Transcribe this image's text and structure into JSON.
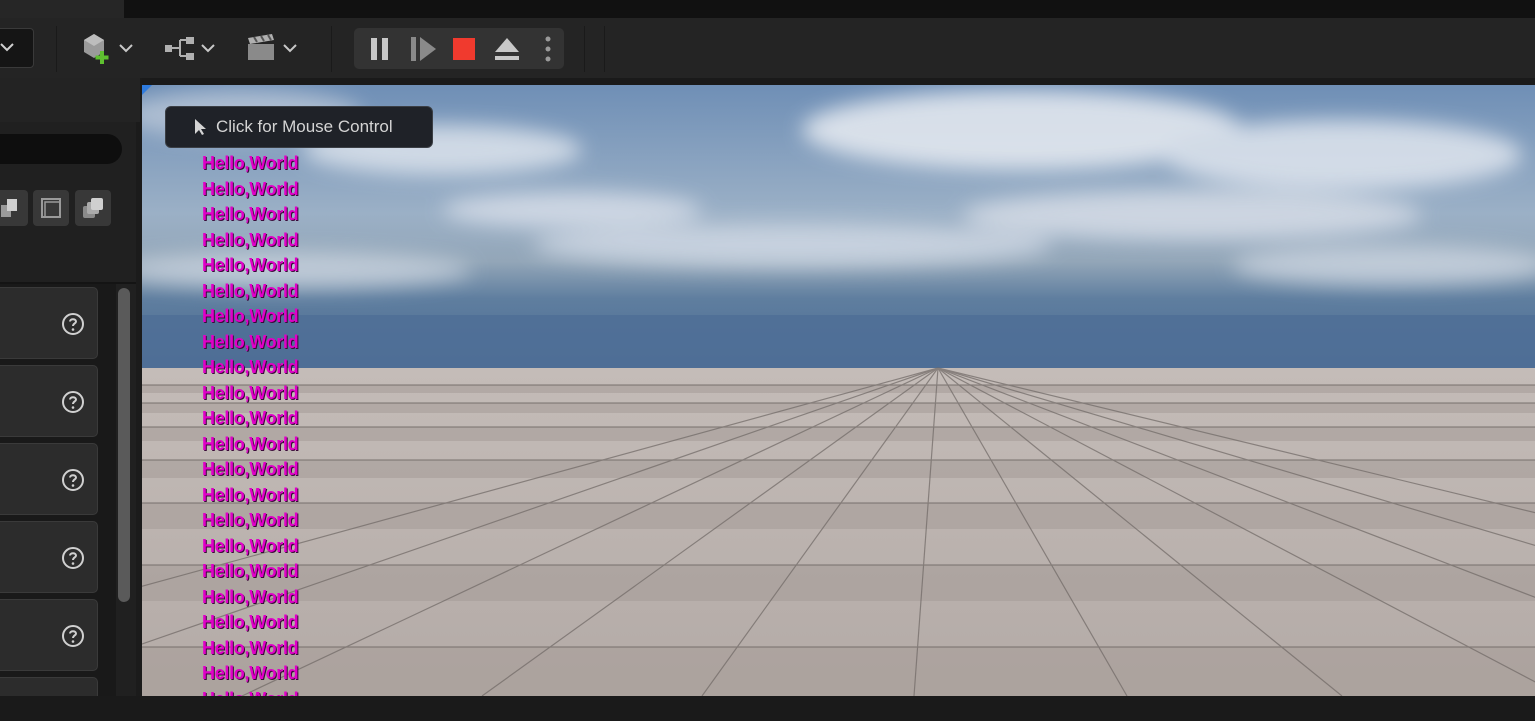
{
  "toolbar": {
    "mode_dropdown_icon": "chevron-down-icon",
    "buttons": [
      {
        "icon": "add-actor-icon"
      },
      {
        "icon": "blueprint-graph-icon"
      },
      {
        "icon": "cinematics-clapper-icon"
      }
    ],
    "play_controls": {
      "pause_icon": "pause-icon",
      "step_icon": "frame-step-icon",
      "stop_icon": "stop-icon",
      "eject_icon": "eject-icon",
      "more_icon": "more-vertical-icon",
      "stop_color": "#f03a2e"
    }
  },
  "left_panel": {
    "view_icons": [
      "layers-icon",
      "single-window-icon",
      "stacked-windows-icon"
    ],
    "cards": [
      {
        "help_icon": "help-icon"
      },
      {
        "help_icon": "help-icon"
      },
      {
        "help_icon": "help-icon"
      },
      {
        "help_icon": "help-icon"
      },
      {
        "help_icon": "help-icon"
      }
    ]
  },
  "viewport": {
    "mouse_control_label": "Click for Mouse Control",
    "debug_text_color": "#e000c8",
    "debug_lines": [
      "Hello,World",
      "Hello,World",
      "Hello,World",
      "Hello,World",
      "Hello,World",
      "Hello,World",
      "Hello,World",
      "Hello,World",
      "Hello,World",
      "Hello,World",
      "Hello,World",
      "Hello,World",
      "Hello,World",
      "Hello,World",
      "Hello,World",
      "Hello,World",
      "Hello,World",
      "Hello,World",
      "Hello,World",
      "Hello,World",
      "Hello,World",
      "Hello,World"
    ]
  }
}
